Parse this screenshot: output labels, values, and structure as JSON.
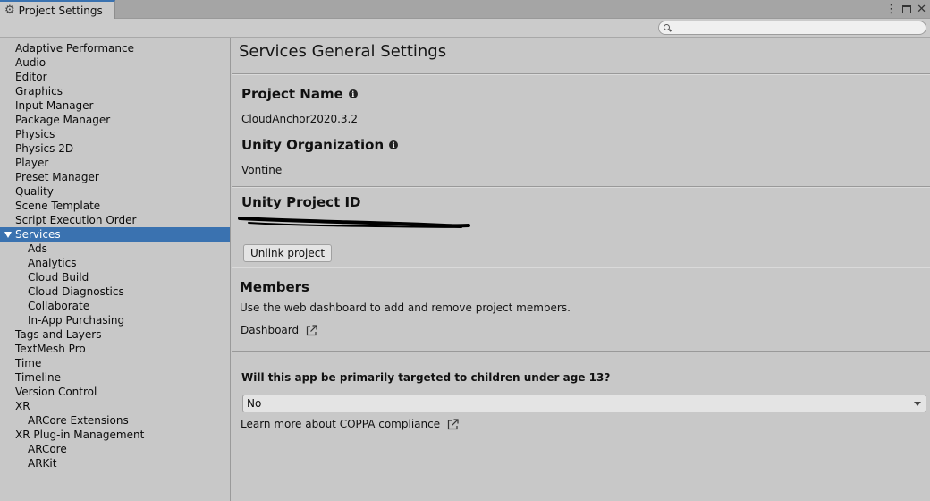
{
  "window": {
    "tab_title": "Project Settings"
  },
  "search": {
    "value": "",
    "placeholder": ""
  },
  "sidebar": {
    "items": [
      {
        "label": "Adaptive Performance",
        "level": 0
      },
      {
        "label": "Audio",
        "level": 0
      },
      {
        "label": "Editor",
        "level": 0
      },
      {
        "label": "Graphics",
        "level": 0
      },
      {
        "label": "Input Manager",
        "level": 0
      },
      {
        "label": "Package Manager",
        "level": 0
      },
      {
        "label": "Physics",
        "level": 0
      },
      {
        "label": "Physics 2D",
        "level": 0
      },
      {
        "label": "Player",
        "level": 0
      },
      {
        "label": "Preset Manager",
        "level": 0
      },
      {
        "label": "Quality",
        "level": 0
      },
      {
        "label": "Scene Template",
        "level": 0
      },
      {
        "label": "Script Execution Order",
        "level": 0
      },
      {
        "label": "Services",
        "level": 0,
        "selected": true,
        "expanded": true
      },
      {
        "label": "Ads",
        "level": 1
      },
      {
        "label": "Analytics",
        "level": 1
      },
      {
        "label": "Cloud Build",
        "level": 1
      },
      {
        "label": "Cloud Diagnostics",
        "level": 1
      },
      {
        "label": "Collaborate",
        "level": 1
      },
      {
        "label": "In-App Purchasing",
        "level": 1
      },
      {
        "label": "Tags and Layers",
        "level": 0
      },
      {
        "label": "TextMesh Pro",
        "level": 0
      },
      {
        "label": "Time",
        "level": 0
      },
      {
        "label": "Timeline",
        "level": 0
      },
      {
        "label": "Version Control",
        "level": 0
      },
      {
        "label": "XR",
        "level": 0,
        "expanded": true
      },
      {
        "label": "ARCore Extensions",
        "level": 1
      },
      {
        "label": "XR Plug-in Management",
        "level": 0,
        "expanded": true
      },
      {
        "label": "ARCore",
        "level": 1
      },
      {
        "label": "ARKit",
        "level": 1
      }
    ]
  },
  "main": {
    "title": "Services General Settings",
    "project_name_label": "Project Name",
    "project_name_value": "CloudAnchor2020.3.2",
    "organization_label": "Unity Organization",
    "organization_value": "Vontine",
    "project_id_label": "Unity Project ID",
    "unlink_button": "Unlink project",
    "members_label": "Members",
    "members_desc": "Use the web dashboard to add and remove project members.",
    "dashboard_link": "Dashboard",
    "coppa_question": "Will this app be primarily targeted to children under age 13?",
    "coppa_selected": "No",
    "coppa_link": "Learn more about COPPA compliance"
  },
  "colors": {
    "selection": "#3a72b0",
    "panel_bg": "#c8c8c8"
  }
}
